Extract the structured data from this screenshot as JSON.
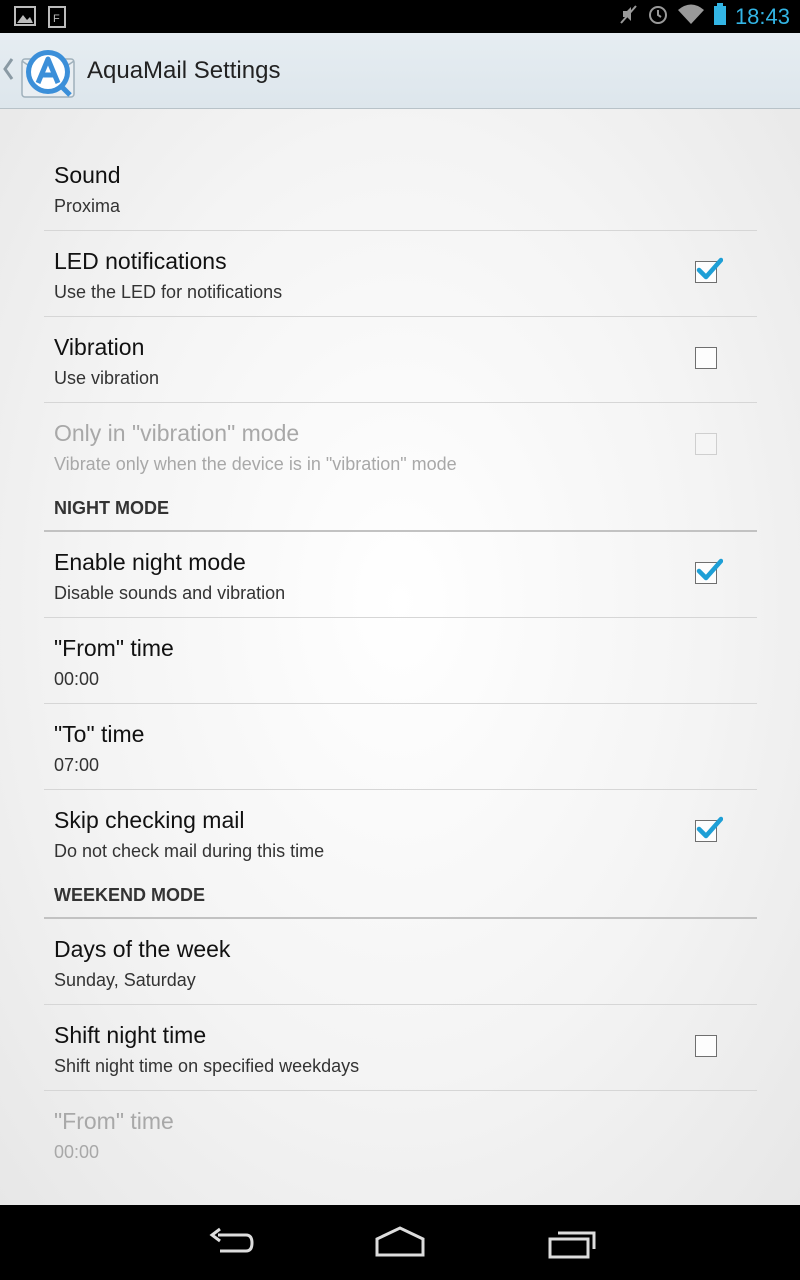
{
  "status_bar": {
    "time": "18:43",
    "left_icons": [
      "picture-icon",
      "flipboard-icon"
    ],
    "right_icons": [
      "mute-icon",
      "alarm-icon",
      "wifi-icon",
      "battery-icon"
    ]
  },
  "action_bar": {
    "title": "AquaMail Settings",
    "up_icon": "back-caret-icon",
    "logo_icon": "aquamail-logo-icon"
  },
  "settings": [
    {
      "type": "item",
      "title": "Sound",
      "summary": "Proxima",
      "checkbox": null,
      "enabled": true
    },
    {
      "type": "item",
      "title": "LED notifications",
      "summary": "Use the LED for notifications",
      "checkbox": true,
      "enabled": true
    },
    {
      "type": "item",
      "title": "Vibration",
      "summary": "Use vibration",
      "checkbox": false,
      "enabled": true
    },
    {
      "type": "item",
      "title": "Only in \"vibration\" mode",
      "summary": "Vibrate only when the device is in \"vibration\" mode",
      "checkbox": false,
      "enabled": false
    },
    {
      "type": "section",
      "title": "NIGHT MODE"
    },
    {
      "type": "item",
      "title": "Enable night mode",
      "summary": "Disable sounds and vibration",
      "checkbox": true,
      "enabled": true
    },
    {
      "type": "item",
      "title": "\"From\" time",
      "summary": "00:00",
      "checkbox": null,
      "enabled": true
    },
    {
      "type": "item",
      "title": "\"To\" time",
      "summary": "07:00",
      "checkbox": null,
      "enabled": true
    },
    {
      "type": "item",
      "title": "Skip checking mail",
      "summary": "Do not check mail during this time",
      "checkbox": true,
      "enabled": true
    },
    {
      "type": "section",
      "title": "WEEKEND MODE"
    },
    {
      "type": "item",
      "title": "Days of the week",
      "summary": "Sunday, Saturday",
      "checkbox": null,
      "enabled": true
    },
    {
      "type": "item",
      "title": "Shift night time",
      "summary": "Shift night time on specified weekdays",
      "checkbox": false,
      "enabled": true
    },
    {
      "type": "item",
      "title": "\"From\" time",
      "summary": "00:00",
      "checkbox": null,
      "enabled": false
    }
  ],
  "nav_bar": {
    "buttons": [
      "back-icon",
      "home-icon",
      "recent-apps-icon"
    ]
  },
  "colors": {
    "accent": "#33b5e5",
    "check": "#1e9fd6"
  }
}
